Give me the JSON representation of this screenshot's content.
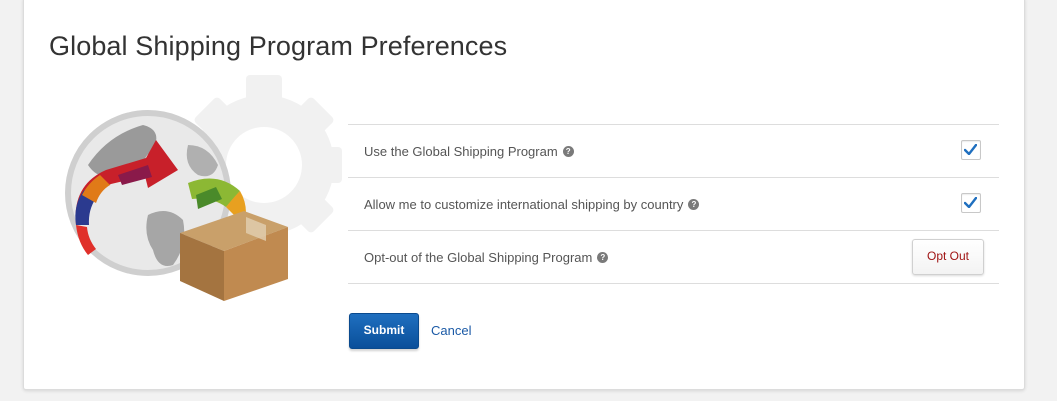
{
  "page": {
    "title": "Global Shipping Program Preferences"
  },
  "preferences": [
    {
      "label": "Use the Global Shipping Program",
      "control": "checkbox",
      "checked": true
    },
    {
      "label": "Allow me to customize international shipping by country",
      "control": "checkbox",
      "checked": true
    },
    {
      "label": "Opt-out of the Global Shipping Program",
      "control": "button",
      "button_label": "Opt Out"
    }
  ],
  "actions": {
    "submit_label": "Submit",
    "cancel_label": "Cancel"
  },
  "icons": {
    "help": "help-question-icon",
    "check": "checkmark-icon"
  },
  "colors": {
    "accent": "#0a4f9a",
    "link": "#1b5aa6",
    "optout_text": "#a01414",
    "check": "#1f6fbf"
  }
}
